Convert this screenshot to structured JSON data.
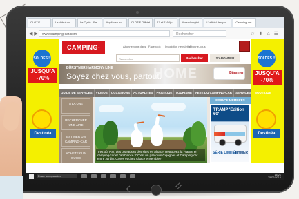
{
  "browser": {
    "tabs": [
      "CLOTIF...",
      "Le début du...",
      "Le Cycle - Re...",
      "Appli web no...",
      "CLOTIF Officiel",
      "17 ef 1164(p...",
      "Nouvel onglet",
      "L'officiel des pro...",
      "Camping-car"
    ],
    "url": "www.camping-car.com",
    "search_placeholder": "Rechercher"
  },
  "site": {
    "logo": "CAMPING-CAR",
    "top_links": [
      "Abonne-vous dans",
      "Facebook",
      "Inscription newsletter",
      "Abonne-vous"
    ],
    "search_placeholder": "Rechercher",
    "search_button": "Rechercher",
    "subscribe_button": "S'ABONNER",
    "banner_small": "BÜRSTNER HARMONY LINE",
    "banner_big": "Soyez chez vous, partout.",
    "banner_word": "HOME",
    "brand": "Bürstner",
    "menu": [
      "GUIDE DE SERVICES",
      "VIDEOS",
      "OCCASIONS",
      "ACTUALITES",
      "PRATIQUE",
      "TOURISME",
      "FETE DU CAMPING-CAR",
      "SERVICES",
      "BOUTIQUE"
    ],
    "sidebar": [
      "A LA UNE",
      "RECHERCHER UNE AIRE",
      "ESTIMER UN CAMPING-CAR",
      "ACHETER UN GUIDE"
    ],
    "caption": "T'es où, PSI, des oiseaux et des sites en Alsace. Retrouvez la France en camping-car et l'ambiance ‘!’ C'est un parcours Cigognes et Camping-car entre Jardin, Caves et chez Alsace ensemble?",
    "members": "ESPACE MEMBRES",
    "ad": {
      "title": "TRAMP 'Edition 60'",
      "serie": "SÉRIE LIMITÉE",
      "brand": "HYMER",
      "tag": "60ème"
    }
  },
  "ads": {
    "left": {
      "sold": "SOLDES !!",
      "promo": "JUSQU'A -70%",
      "brand": "Destinéa"
    },
    "right": {
      "sold": "SOLDES !!",
      "promo": "JUSQU'A -70%",
      "brand": "Destinéa"
    }
  },
  "taskbar": {
    "search": "Poser une question",
    "time": "16:21",
    "date": "25/06/2016"
  }
}
